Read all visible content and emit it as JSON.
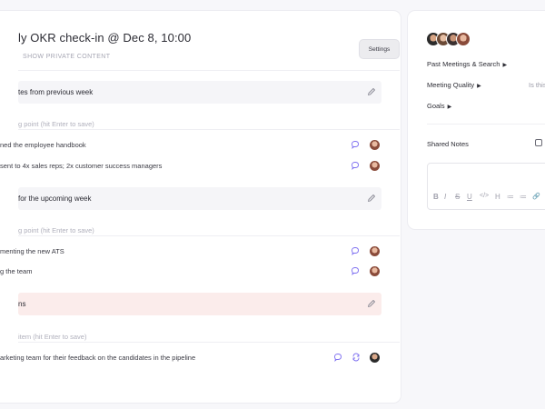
{
  "meeting": {
    "title": "ly OKR check-in @ Dec 8, 10:00",
    "show_private": "SHOW PRIVATE CONTENT",
    "settings_label": "Settings"
  },
  "sections": [
    {
      "label": "tes from previous week",
      "placeholder": "g point (hit Enter to save)",
      "items": [
        "ned the employee handbook",
        "sent to 4x sales reps; 2x customer success managers"
      ]
    },
    {
      "label": "for the upcoming week",
      "placeholder": "g point (hit Enter to save)",
      "items": [
        "menting the new ATS",
        "g the team"
      ]
    },
    {
      "label": "ns",
      "placeholder": "item (hit Enter to save)",
      "items": [
        "arketing team for their feedback on the candidates in the pipeline"
      ]
    }
  ],
  "sidebar": {
    "past_meetings": "Past Meetings & Search",
    "meeting_quality": "Meeting Quality",
    "quality_hint": "Is this",
    "goals": "Goals",
    "shared_notes": "Shared Notes",
    "toolbar": [
      "B",
      "I",
      "S",
      "U",
      "</>",
      "H",
      "≔",
      "≔",
      "🔗"
    ]
  },
  "colors": {
    "accent": "#7c6df0",
    "section_bg": "#f5f5f8",
    "action_bg": "#fbeceb"
  },
  "icons": {
    "edit": "pencil-icon",
    "comment": "comment-icon",
    "repeat": "repeat-icon"
  }
}
